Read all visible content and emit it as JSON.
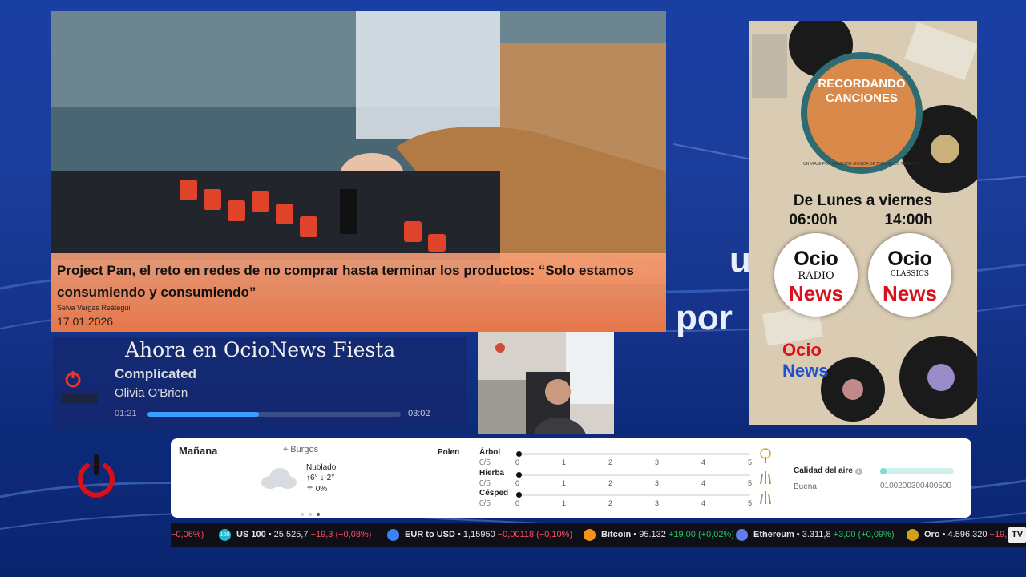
{
  "background": {
    "word_right_1": "u",
    "word_right_2": "por"
  },
  "news": {
    "title": "Project Pan, el reto en redes de no comprar hasta terminar los productos: “Solo estamos consumiendo y consumiendo”",
    "author": "Selva Vargas Reátegui",
    "date": "17.01.2026"
  },
  "now_playing": {
    "heading": "Ahora en OcioNews Fiesta",
    "song": "Complicated",
    "artist": "Olivia O'Brien",
    "elapsed": "01:21",
    "duration": "03:02",
    "progress": 0.44
  },
  "poster": {
    "title_line1": "RECORDANDO",
    "title_line2": "CANCIONES",
    "tagline": "UN VIAJE POR LA MEJOR MÚSICA DE TODOS LOS TIEMPOS",
    "schedule_days": "De Lunes a viernes",
    "time_start": "06:00h",
    "time_end": "14:00h",
    "logo1": {
      "ocio": "Ocio",
      "sub": "RADIO",
      "news": "News"
    },
    "logo2": {
      "ocio": "Ocio",
      "sub": "CLASSICS",
      "news": "News"
    },
    "footer_logo": {
      "ocio": "Ocio",
      "news": "News"
    }
  },
  "weather": {
    "day": "Mañana",
    "location": "Burgos",
    "condition": "Nublado",
    "temp_high": "6°",
    "temp_low": "-2°",
    "rain": "0%",
    "pollen_label": "Polen",
    "pollen": [
      {
        "name": "Árbol",
        "score": "0/5",
        "value": 0,
        "icon": "tree-icon"
      },
      {
        "name": "Hierba",
        "score": "0/5",
        "value": 0,
        "icon": "grass-icon"
      },
      {
        "name": "Césped",
        "score": "0/5",
        "value": 0,
        "icon": "lawn-icon"
      }
    ],
    "scale": [
      "0",
      "1",
      "2",
      "3",
      "4",
      "5"
    ],
    "air_label": "Calidad del aire",
    "air_value": "Buena",
    "air_scale": "0100200300400500",
    "air_level": 0
  },
  "ticker": [
    {
      "name": "",
      "value": "",
      "change": "−0,06%)",
      "dir": "down",
      "color": "#e5e5e5"
    },
    {
      "name": "US 100",
      "value": "25.525,7",
      "change": "−19,3 (−0,08%)",
      "dir": "down",
      "color": "#22b8cf",
      "icon_text": "100"
    },
    {
      "name": "EUR to USD",
      "value": "1,15950",
      "change": "−0,00118 (−0,10%)",
      "dir": "down",
      "color": "#3b82f6"
    },
    {
      "name": "Bitcoin",
      "value": "95.132",
      "change": "+19,00 (+0,02%)",
      "dir": "up",
      "color": "#f7931a"
    },
    {
      "name": "Ethereum",
      "value": "3.311,8",
      "change": "+3,00 (+0,09%)",
      "dir": "up",
      "color": "#627eea"
    },
    {
      "name": "Oro",
      "value": "4.596,320",
      "change": "−19,",
      "dir": "down",
      "color": "#d4a017"
    }
  ],
  "ticker_brand": "TV"
}
